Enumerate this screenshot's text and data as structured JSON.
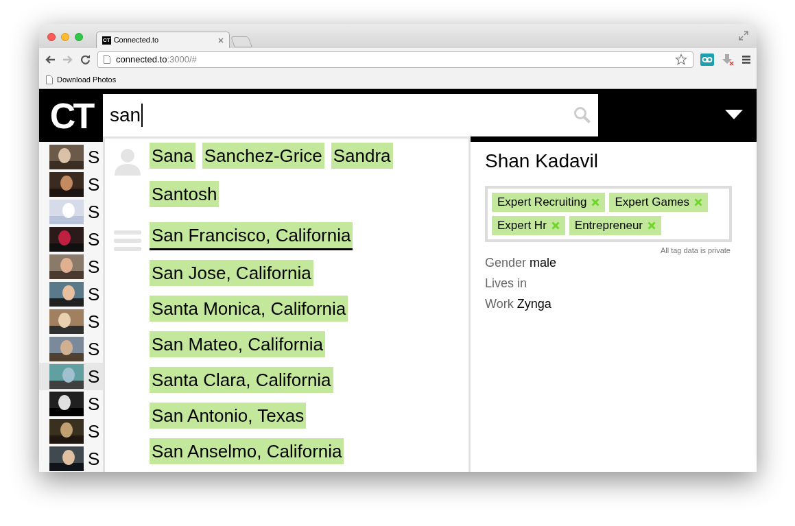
{
  "browser": {
    "tab": {
      "favicon_text": "CT",
      "title": "Connected.to",
      "selected": true
    },
    "address": {
      "host": "connected.to",
      "rest": ":3000/#"
    },
    "bookmarks": [
      "Download Photos"
    ]
  },
  "app": {
    "logo": "CT",
    "search": {
      "value": "san"
    }
  },
  "people": [
    {
      "initial": "S",
      "selected": false
    },
    {
      "initial": "S",
      "selected": false
    },
    {
      "initial": "S",
      "selected": false
    },
    {
      "initial": "S",
      "selected": false
    },
    {
      "initial": "S",
      "selected": false
    },
    {
      "initial": "S",
      "selected": false
    },
    {
      "initial": "S",
      "selected": false
    },
    {
      "initial": "S",
      "selected": false
    },
    {
      "initial": "S",
      "selected": true
    },
    {
      "initial": "S",
      "selected": false
    },
    {
      "initial": "S",
      "selected": false
    },
    {
      "initial": "S",
      "selected": false
    }
  ],
  "suggestions": {
    "names": [
      "Sana",
      "Sanchez-Grice",
      "Sandra",
      "Santosh"
    ],
    "places": [
      {
        "label": "San Francisco, California",
        "selected": true
      },
      {
        "label": "San Jose, California",
        "selected": false
      },
      {
        "label": "Santa Monica, California",
        "selected": false
      },
      {
        "label": "San Mateo, California",
        "selected": false
      },
      {
        "label": "Santa Clara, California",
        "selected": false
      },
      {
        "label": "San Antonio, Texas",
        "selected": false
      },
      {
        "label": "San Anselmo, California",
        "selected": false
      }
    ]
  },
  "profile": {
    "name": "Shan Kadavil",
    "tags": [
      "Expert Recruiting",
      "Expert Games",
      "Expert Hr",
      "Entrepreneur"
    ],
    "tag_note": "All tag data is private",
    "fields": [
      {
        "label": "Gender",
        "value": "male"
      },
      {
        "label": "Lives in"
      },
      {
        "label": "Work",
        "value": "Zynga"
      }
    ]
  }
}
